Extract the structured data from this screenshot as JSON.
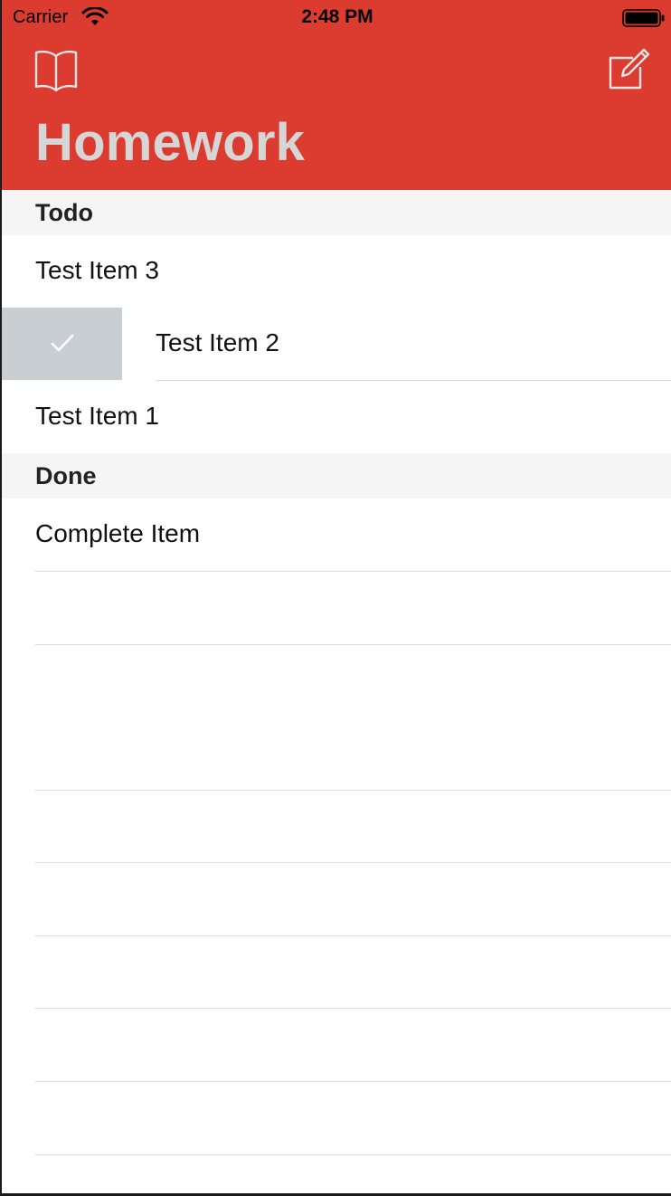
{
  "status_bar": {
    "carrier": "Carrier",
    "time": "2:48 PM"
  },
  "nav": {
    "left_icon": "book-icon",
    "right_icon": "compose-icon",
    "title": "Homework"
  },
  "sections": {
    "todo": {
      "header": "Todo",
      "items": [
        "Test Item 3",
        "Test Item 2",
        "Test Item 1"
      ]
    },
    "done": {
      "header": "Done",
      "items": [
        "Complete Item"
      ]
    }
  },
  "swipe_action": {
    "icon": "checkmark-icon"
  },
  "colors": {
    "header_bg": "#dc3c2f",
    "title_text": "#d6d6d6",
    "swipe_action_bg": "#c9ced2",
    "section_header_bg": "#f5f5f5"
  }
}
